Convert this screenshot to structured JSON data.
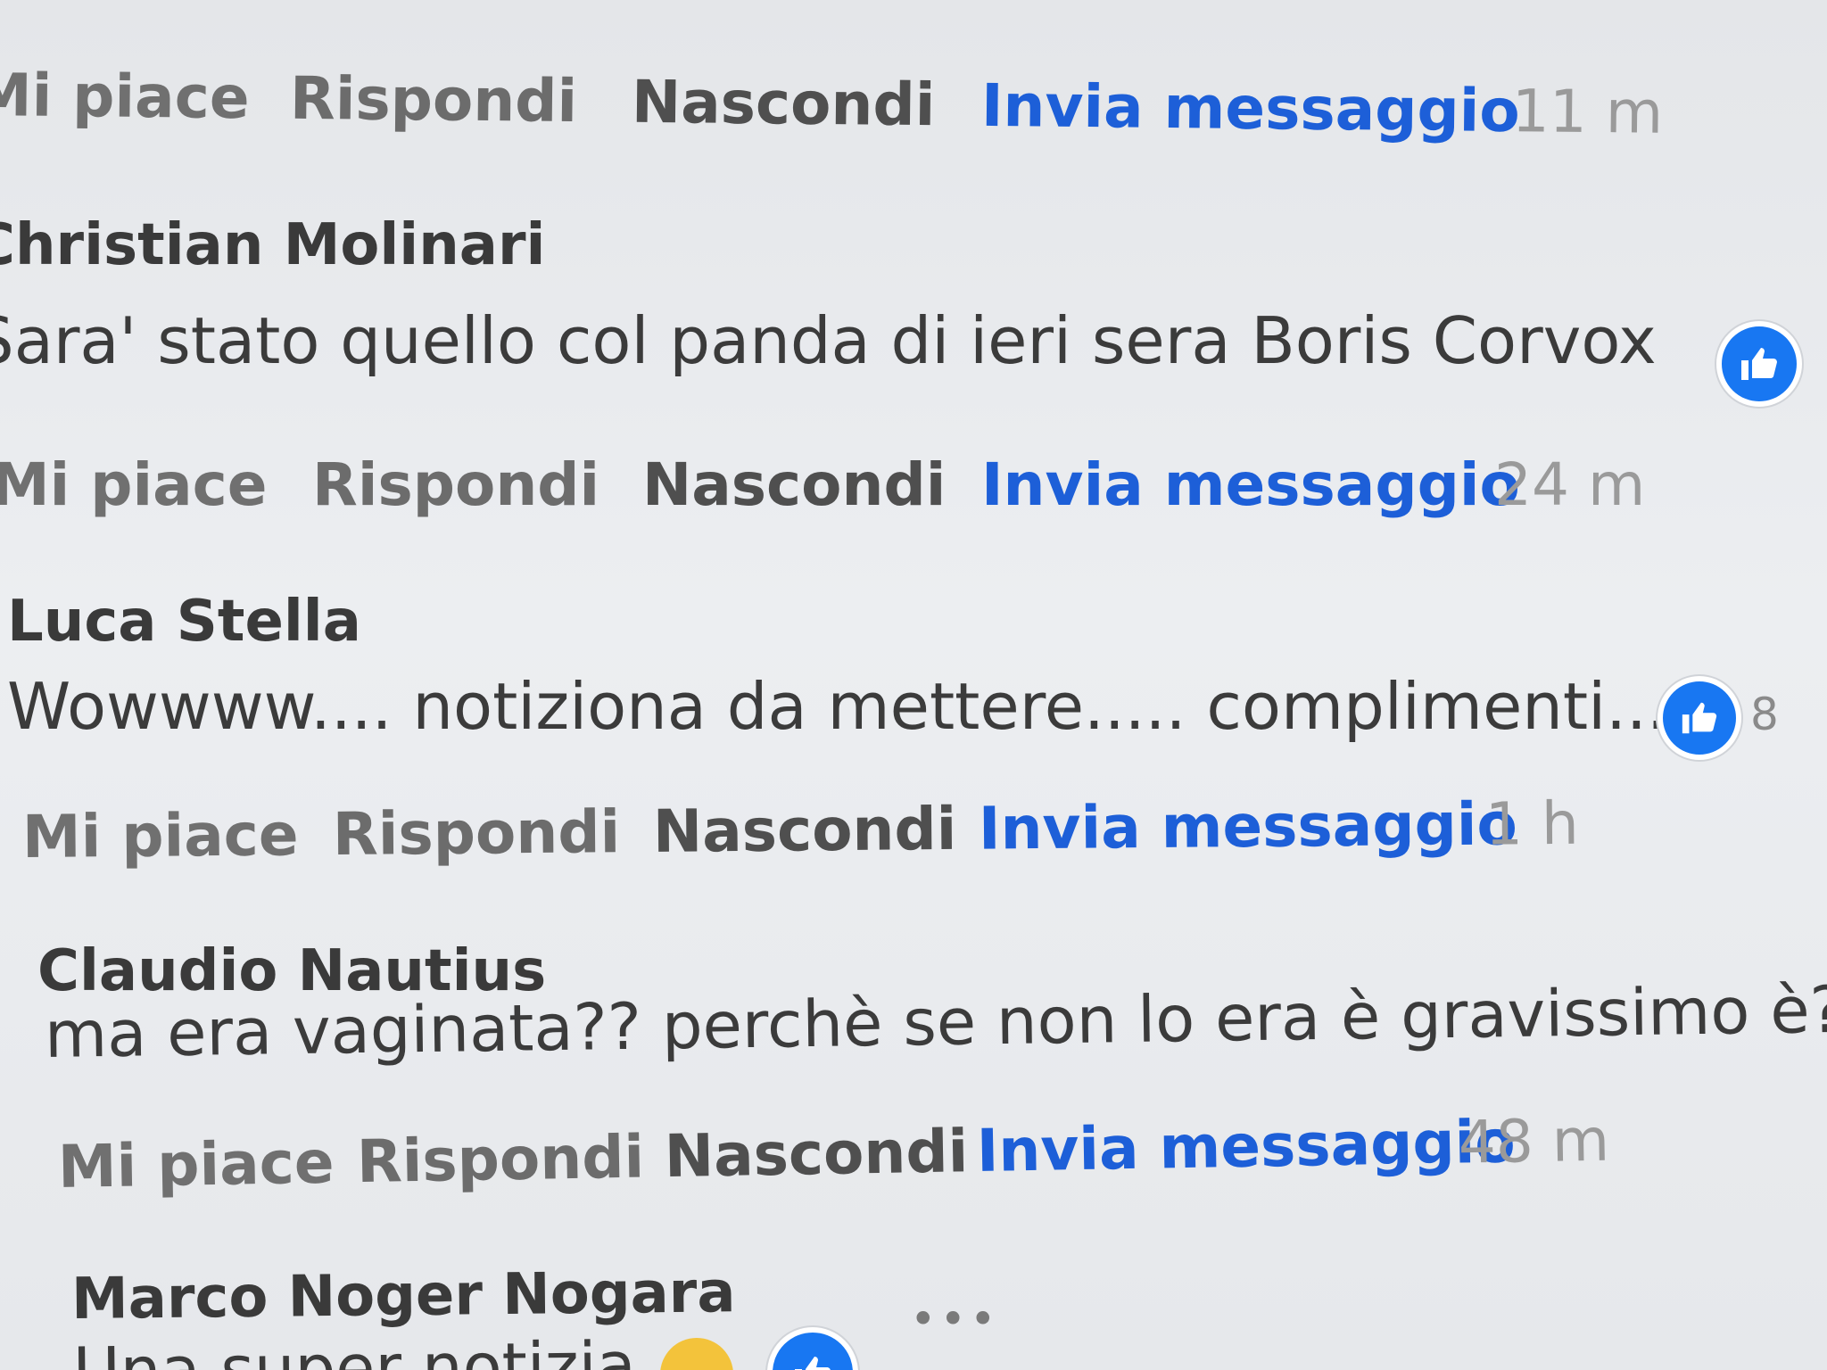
{
  "comments": [
    {
      "actions": {
        "like": "Mi piace",
        "reply": "Rispondi",
        "hide": "Nascondi",
        "message": "Invia messaggio",
        "time": "11 m"
      }
    },
    {
      "author": "Christian Molinari",
      "text": "Sara' stato quello col panda di ieri sera Boris Corvox",
      "actions": {
        "like": "Mi piace",
        "reply": "Rispondi",
        "hide": "Nascondi",
        "message": "Invia messaggio",
        "time": "24 m"
      }
    },
    {
      "author": "Luca Stella",
      "text": "Wowwww.... notiziona da mettere..... complimenti....",
      "like_count": "8",
      "actions": {
        "like": "Mi piace",
        "reply": "Rispondi",
        "hide": "Nascondi",
        "message": "Invia messaggio",
        "time": "1 h"
      }
    },
    {
      "author": "Claudio Nautius",
      "text": "ma era vaginata?? perchè se non lo era è gravissimo è???",
      "actions": {
        "like": "Mi piace",
        "reply": "Rispondi",
        "hide": "Nascondi",
        "message": "Invia messaggio",
        "time": "48 m"
      }
    },
    {
      "author": "Marco Noger Nogara",
      "text": "Una super notizia",
      "more": "•••"
    }
  ],
  "colors": {
    "link_blue": "#1d5fd8",
    "like_blue": "#1877f2",
    "background": "#e9ebee"
  },
  "icons": {
    "like": "thumbs-up-icon",
    "more": "more-options-icon"
  }
}
